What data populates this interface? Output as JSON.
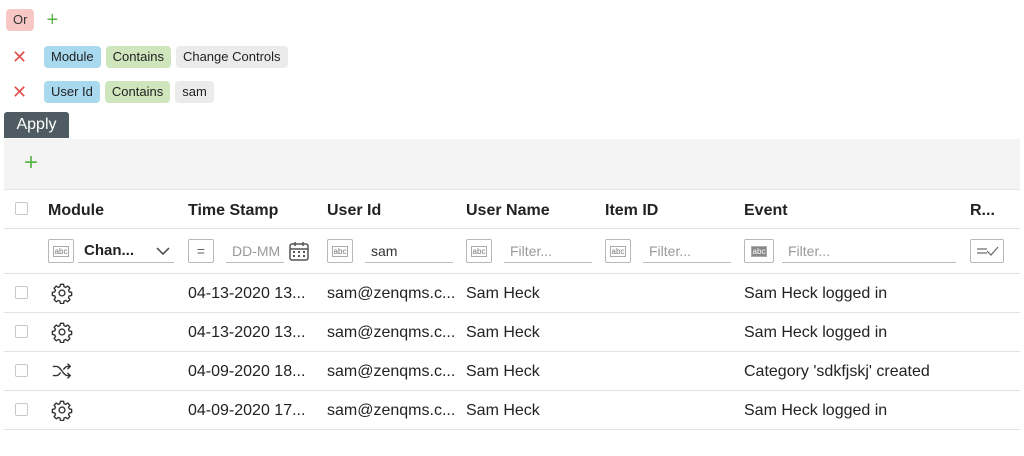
{
  "filter": {
    "logic": "Or",
    "conditions": [
      {
        "field": "Module",
        "operator": "Contains",
        "value": "Change Controls"
      },
      {
        "field": "User Id",
        "operator": "Contains",
        "value": "sam"
      }
    ],
    "apply_label": "Apply"
  },
  "grid": {
    "columns": [
      "Module",
      "Time Stamp",
      "User Id",
      "User Name",
      "Item ID",
      "Event",
      "R..."
    ],
    "filters": {
      "module_value": "Chan...",
      "timestamp_placeholder": "DD-MM",
      "userid_value": "sam",
      "username_placeholder": "Filter...",
      "itemid_placeholder": "Filter...",
      "event_placeholder": "Filter..."
    },
    "rows": [
      {
        "module_icon": "gear-icon",
        "timestamp": "04-13-2020 13...",
        "user_id": "sam@zenqms.c...",
        "user_name": "Sam Heck",
        "item_id": "",
        "event": "Sam Heck logged in"
      },
      {
        "module_icon": "gear-icon",
        "timestamp": "04-13-2020 13...",
        "user_id": "sam@zenqms.c...",
        "user_name": "Sam Heck",
        "item_id": "",
        "event": "Sam Heck logged in"
      },
      {
        "module_icon": "shuffle-icon",
        "timestamp": "04-09-2020 18...",
        "user_id": "sam@zenqms.c...",
        "user_name": "Sam Heck",
        "item_id": "",
        "event": "Category 'sdkfjskj' created"
      },
      {
        "module_icon": "gear-icon",
        "timestamp": "04-09-2020 17...",
        "user_id": "sam@zenqms.c...",
        "user_name": "Sam Heck",
        "item_id": "",
        "event": "Sam Heck logged in"
      }
    ]
  },
  "colors": {
    "or_chip": "#f6c7c4",
    "field_chip": "#a8d9ee",
    "operator_chip": "#cfe6bd",
    "value_chip": "#ebebeb",
    "remove": "#e0524d",
    "add": "#5cb54a",
    "apply_button": "#4f5b62"
  }
}
